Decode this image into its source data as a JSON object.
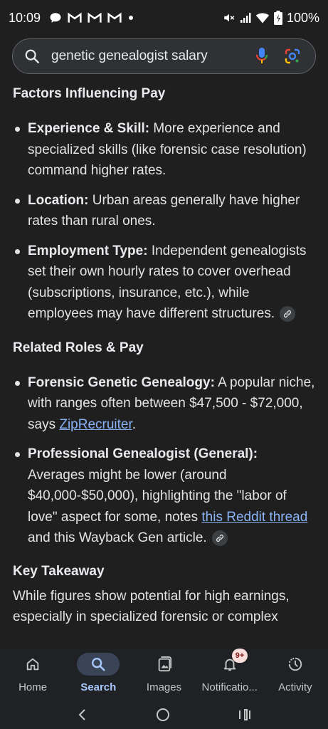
{
  "status_bar": {
    "time": "10:09",
    "battery": "100%",
    "notification_icons": [
      "chat-icon",
      "gmail-icon",
      "gmail-icon",
      "gmail-icon",
      "dot-icon"
    ],
    "system_icons": [
      "mute-icon",
      "signal-icon",
      "wifi-icon",
      "battery-icon"
    ]
  },
  "search": {
    "query": "genetic genealogist salary"
  },
  "content": {
    "section1": {
      "heading": "Factors Influencing Pay",
      "items": [
        {
          "term": "Experience & Skill:",
          "text": " More experience and specialized skills (like forensic case resolution) command higher rates."
        },
        {
          "term": "Location:",
          "text": " Urban areas generally have higher rates than rural ones."
        },
        {
          "term": "Employment Type:",
          "text": " Independent genealogists set their own hourly rates to cover overhead (subscriptions, insurance, etc.), while employees may have different structures."
        }
      ]
    },
    "section2": {
      "heading": "Related Roles & Pay",
      "item1": {
        "term": "Forensic Genetic Genealogy:",
        "text": " A popular niche, with ranges often between $47,500 - $72,000, says ",
        "link": "ZipRecruiter",
        "tail": "."
      },
      "item2": {
        "term": "Professional Genealogist (General):",
        "text": " Averages might be lower (around $40,000-$50,000), highlighting the \"labor of love\" aspect for some, notes ",
        "link": "this Reddit thread",
        "tail": " and this Wayback Gen article."
      }
    },
    "section3": {
      "heading": "Key Takeaway",
      "text": "While figures show potential for high earnings, especially in specialized forensic or complex"
    }
  },
  "bottom_nav": {
    "items": [
      {
        "label": "Home",
        "icon": "home-icon"
      },
      {
        "label": "Search",
        "icon": "search-icon",
        "active": true
      },
      {
        "label": "Images",
        "icon": "images-icon"
      },
      {
        "label": "Notificatio...",
        "icon": "bell-icon",
        "badge": "9+"
      },
      {
        "label": "Activity",
        "icon": "activity-icon"
      }
    ]
  },
  "colors": {
    "background": "#1f1f1f",
    "link": "#8ab4f8",
    "active_nav": "#a8c7fa"
  }
}
